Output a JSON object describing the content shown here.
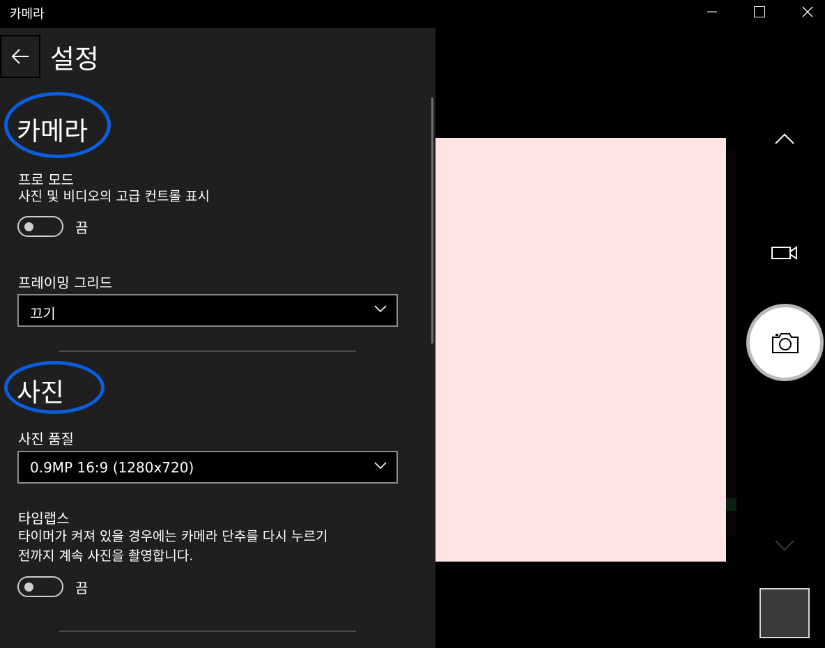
{
  "window": {
    "title": "카메라"
  },
  "settings": {
    "title": "설정",
    "camera_section": {
      "title": "카메라",
      "pro_mode": {
        "label": "프로 모드",
        "description": "사진 및 비디오의 고급 컨트롤 표시",
        "state": "끔"
      },
      "framing_grid": {
        "label": "프레이밍 그리드",
        "value": "끄기"
      }
    },
    "photo_section": {
      "title": "사진",
      "photo_quality": {
        "label": "사진 품질",
        "value": "0.9MP 16:9 (1280x720)"
      },
      "timelapse": {
        "label": "타임랩스",
        "description_line1": "타이머가 켜져 있을 경우에는 카메라 단추를 다시 누르기",
        "description_line2": "전까지 계속 사진을 촬영합니다.",
        "state": "끔"
      }
    }
  },
  "camera_controls": {
    "icons": [
      "chevron-up-icon",
      "video-camera-icon",
      "camera-icon",
      "chevron-down-icon"
    ]
  },
  "colors": {
    "highlight": "#0a5fe0",
    "panel_bg": "#1f1f1f",
    "preview_bg": "#ffe4e3"
  }
}
